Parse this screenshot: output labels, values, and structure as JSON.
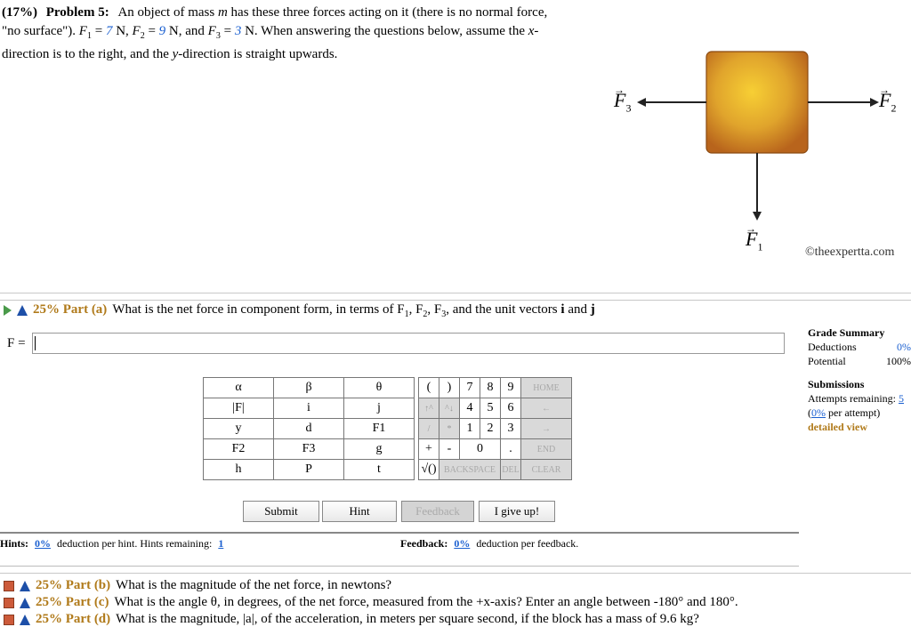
{
  "problem": {
    "pct": "(17%)",
    "num": "Problem 5:",
    "text1": "An object of mass ",
    "m": "m",
    "text2": " has these three forces acting on it (there is no normal force,",
    "line2a": "\"no surface\"). ",
    "F1": "F",
    "F1v": "7",
    "F2v": "9",
    "F3v": "3",
    "line2b": " N. When answering the questions below, assume the ",
    "x": "x",
    "line3a": "direction is to the right, and the ",
    "y": "y",
    "line3b": "-direction is straight upwards."
  },
  "diagram": {
    "label_f1": "F",
    "sub_f1": "1",
    "label_f2": "F",
    "sub_f2": "2",
    "label_f3": "F",
    "sub_f3": "3",
    "copyright": "©theexpertta.com"
  },
  "part_a": {
    "pct": "25% Part (a)",
    "question": "What is the net force in component form, in terms of F",
    "q_tail": ", and the unit vectors ",
    "i": "i",
    "and": " and ",
    "j": "j",
    "answer_label": "F =",
    "answer_value": ""
  },
  "keypad": {
    "symbols": [
      [
        "α",
        "β",
        "θ"
      ],
      [
        "|F|",
        "i",
        "j"
      ],
      [
        "y",
        "d",
        "F1"
      ],
      [
        "F2",
        "F3",
        "g"
      ],
      [
        "h",
        "P",
        "t"
      ]
    ],
    "nums": [
      [
        "(",
        ")",
        "7",
        "8",
        "9",
        "HOME"
      ],
      [
        "↑^",
        "^↓",
        "4",
        "5",
        "6",
        "←"
      ],
      [
        "/",
        "*",
        "1",
        "2",
        "3",
        "→"
      ],
      [
        "+",
        "-",
        "0",
        ".",
        "END"
      ],
      [
        "√()",
        "BACKSPACE",
        "DEL",
        "CLEAR"
      ]
    ]
  },
  "buttons": {
    "submit": "Submit",
    "hint": "Hint",
    "feedback": "Feedback",
    "giveup": "I give up!"
  },
  "hints": {
    "label": "Hints:",
    "pct": "0%",
    "text": "deduction per hint. Hints remaining:",
    "remaining": "1",
    "fb_label": "Feedback:",
    "fb_pct": "0%",
    "fb_text": "deduction per feedback."
  },
  "grade": {
    "title": "Grade Summary",
    "deductions_label": "Deductions",
    "deductions_val": "0%",
    "potential_label": "Potential",
    "potential_val": "100%",
    "submissions": "Submissions",
    "attempts": "Attempts remaining:",
    "attempts_val": "5",
    "per": "per attempt)",
    "per_pct": "0%",
    "detailed": "detailed view"
  },
  "parts": [
    {
      "pct": "25% Part (b)",
      "text": "What is the magnitude of the net force, in newtons?"
    },
    {
      "pct": "25% Part (c)",
      "text": "What is the angle θ, in degrees, of the net force, measured from the +x-axis? Enter an angle between -180° and 180°."
    },
    {
      "pct": "25% Part (d)",
      "text": "What is the magnitude, |a|, of the acceleration, in meters per square second, if the block has a mass of 9.6 kg?"
    }
  ],
  "colors": {
    "accent": "#1a5fd0",
    "gold": "#b07a1a",
    "box": "#d98a26"
  }
}
